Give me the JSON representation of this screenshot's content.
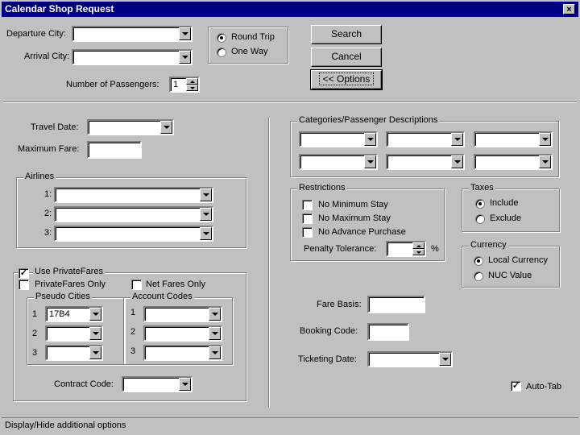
{
  "window": {
    "title": "Calendar Shop Request",
    "close_glyph": "×"
  },
  "top": {
    "departure_label": "Departure City:",
    "departure_value": "",
    "arrival_label": "Arrival City:",
    "arrival_value": "",
    "trip_round": "Round Trip",
    "trip_oneway": "One Way",
    "trip_selected": "round",
    "passengers_label": "Number of Passengers:",
    "passengers_value": "1",
    "search_button": "Search",
    "cancel_button": "Cancel",
    "options_button": "<< Options"
  },
  "travel": {
    "travel_date_label": "Travel Date:",
    "travel_date_value": "",
    "max_fare_label": "Maximum Fare:",
    "max_fare_value": ""
  },
  "airlines": {
    "title": "Airlines",
    "rows": [
      {
        "label": "1:",
        "value": ""
      },
      {
        "label": "2:",
        "value": ""
      },
      {
        "label": "3:",
        "value": ""
      }
    ]
  },
  "private_fares": {
    "use_label": "Use PrivateFares",
    "use_checked": true,
    "only_label": "PrivateFares Only",
    "only_checked": false,
    "net_label": "Net Fares Only",
    "net_checked": false,
    "pseudo_title": "Pseudo Cities",
    "pseudo_rows": [
      {
        "label": "1",
        "value": "17B4"
      },
      {
        "label": "2",
        "value": ""
      },
      {
        "label": "3",
        "value": ""
      }
    ],
    "account_title": "Account Codes",
    "account_rows": [
      {
        "label": "1",
        "value": ""
      },
      {
        "label": "2",
        "value": ""
      },
      {
        "label": "3",
        "value": ""
      }
    ],
    "contract_label": "Contract Code:",
    "contract_value": ""
  },
  "categories": {
    "title": "Categories/Passenger Descriptions"
  },
  "restrictions": {
    "title": "Restrictions",
    "no_min_stay": "No Minimum Stay",
    "no_max_stay": "No Maximum Stay",
    "no_adv_purchase": "No Advance Purchase",
    "penalty_label": "Penalty Tolerance:",
    "penalty_value": "",
    "penalty_unit": "%"
  },
  "taxes": {
    "title": "Taxes",
    "include": "Include",
    "exclude": "Exclude",
    "selected": "include"
  },
  "currency": {
    "title": "Currency",
    "local": "Local Currency",
    "nuc": "NUC Value",
    "selected": "local"
  },
  "misc": {
    "fare_basis_label": "Fare Basis:",
    "booking_code_label": "Booking Code:",
    "ticketing_date_label": "Ticketing Date:",
    "auto_tab_label": "Auto-Tab",
    "auto_tab_checked": true
  },
  "status": {
    "text": "Display/Hide additional options"
  }
}
